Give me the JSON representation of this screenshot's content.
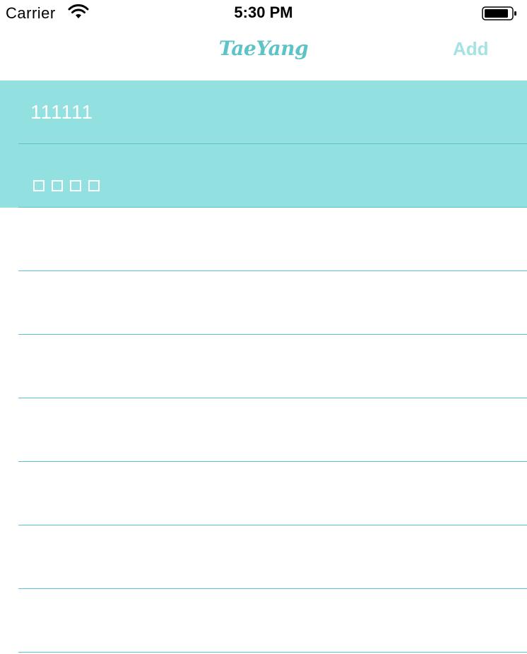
{
  "status_bar": {
    "carrier": "Carrier",
    "time": "5:30 PM",
    "wifi_icon": "wifi-icon",
    "battery_icon": "battery-icon"
  },
  "nav_bar": {
    "title": "TaeYang",
    "add_label": "Add",
    "title_color": "#5ec3c6",
    "add_color": "#a5e2e4"
  },
  "list": {
    "accent_color": "#93e0e1",
    "separator_color": "#5ec2cd",
    "rows": [
      {
        "text": "111111"
      },
      {
        "text": "□□□□"
      },
      {
        "text": ""
      },
      {
        "text": ""
      },
      {
        "text": ""
      },
      {
        "text": ""
      },
      {
        "text": ""
      },
      {
        "text": ""
      },
      {
        "text": ""
      }
    ]
  }
}
